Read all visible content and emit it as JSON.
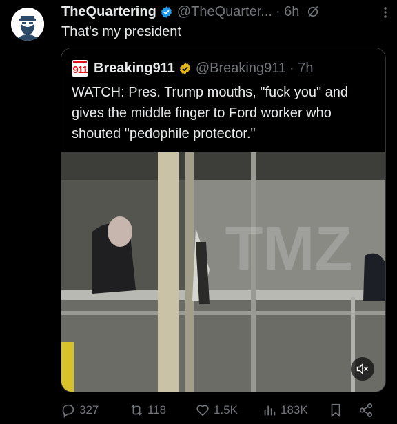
{
  "tweet": {
    "author_name": "TheQuartering",
    "author_handle": "@TheQuarter...",
    "time": "· 6h",
    "text": "That's my president"
  },
  "quote": {
    "logo_text": "911",
    "author_name": "Breaking911",
    "author_handle": "@Breaking911",
    "time": "· 7h",
    "text": "WATCH: Pres. Trump mouths, \"fuck you\" and gives the middle finger to Ford worker who shouted \"pedophile protector.\"",
    "video_watermark": "TMZ"
  },
  "actions": {
    "replies": "327",
    "reposts": "118",
    "likes": "1.5K",
    "views": "183K"
  },
  "colors": {
    "verified": "#1d9bf0",
    "verified_gold": "#e2b719",
    "muted": "#71767b",
    "border": "#2f3336"
  },
  "icons": [
    "grok-icon",
    "more-icon",
    "verified-icon",
    "mute-icon",
    "reply-icon",
    "repost-icon",
    "like-icon",
    "views-icon",
    "bookmark-icon",
    "share-icon"
  ]
}
